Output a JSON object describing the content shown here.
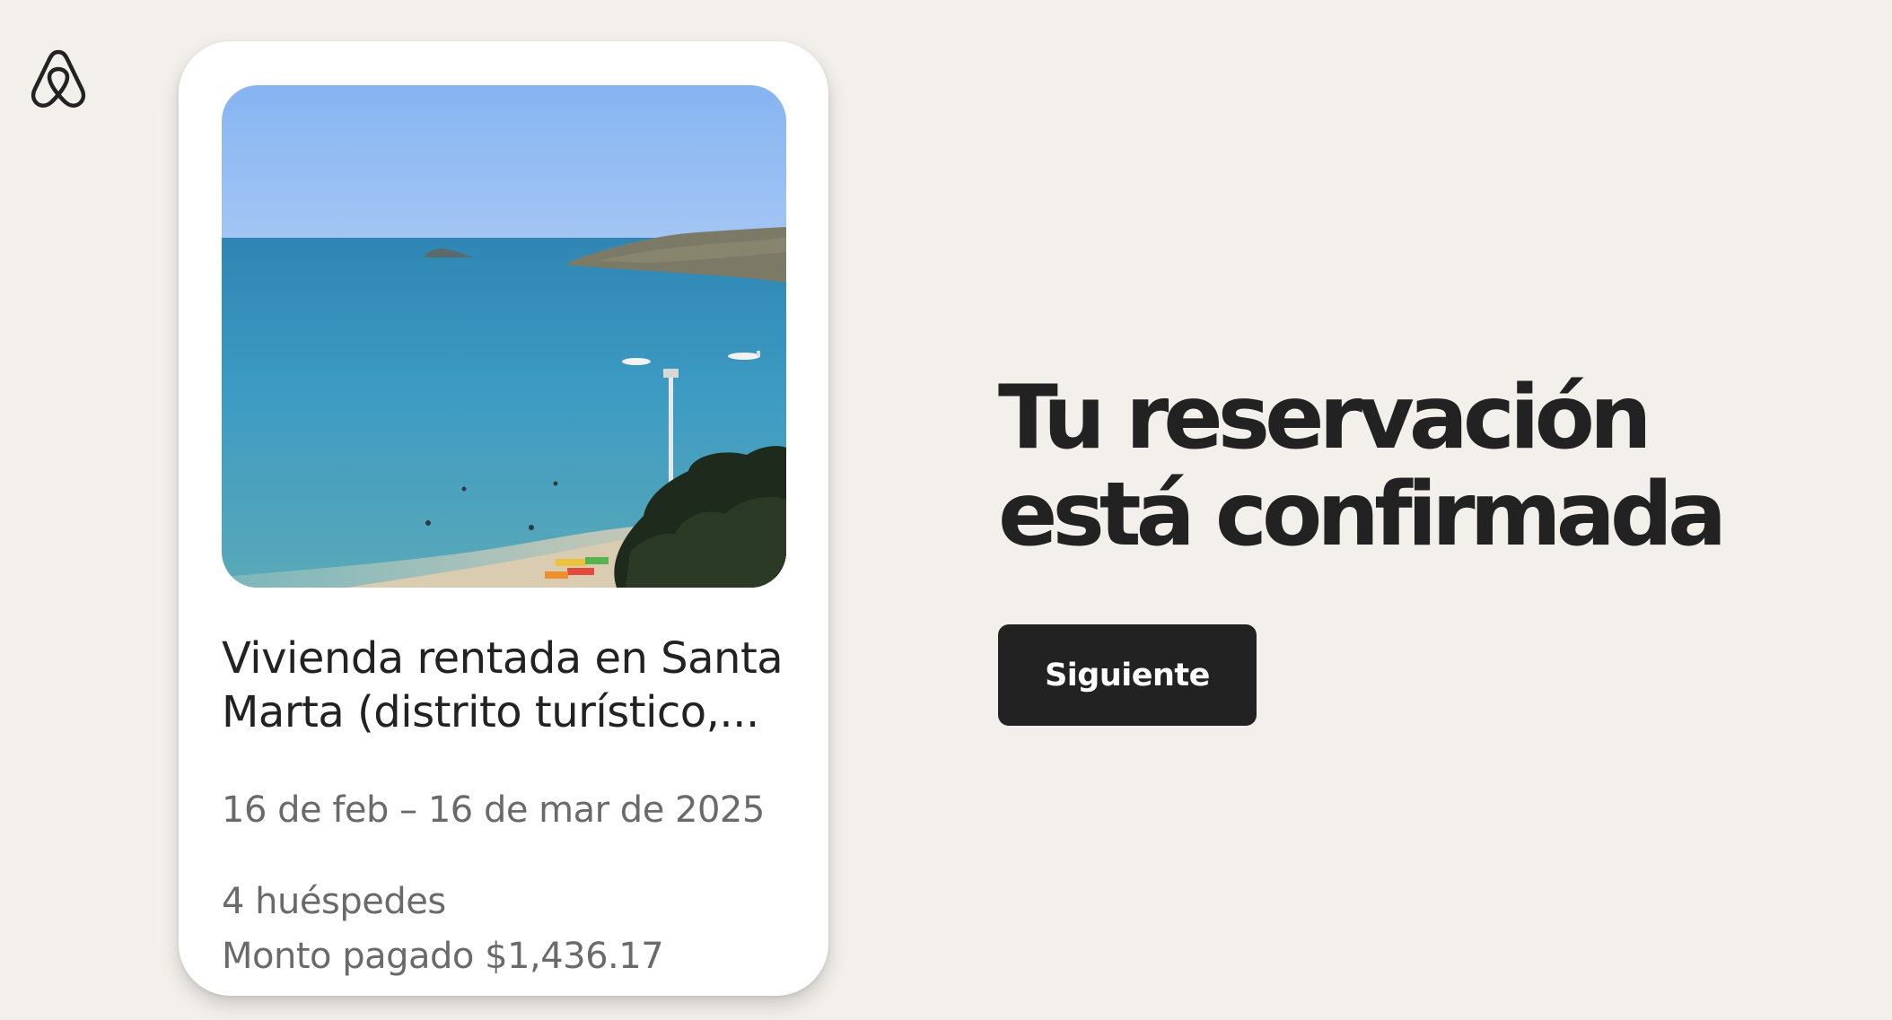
{
  "brand": {
    "logo_icon": "airbnb-logo-icon"
  },
  "listing": {
    "title": "Vivienda rentada en Santa Marta (distrito turístico,...",
    "dates": "16 de feb – 16 de mar de 2025",
    "guests": "4 huéspedes",
    "amount_paid": "Monto pagado $1,436.17",
    "photo_icon": "beach-photo"
  },
  "confirmation": {
    "headline_line1": "Tu reservación",
    "headline_line2": "está confirmada",
    "next_label": "Siguiente"
  }
}
